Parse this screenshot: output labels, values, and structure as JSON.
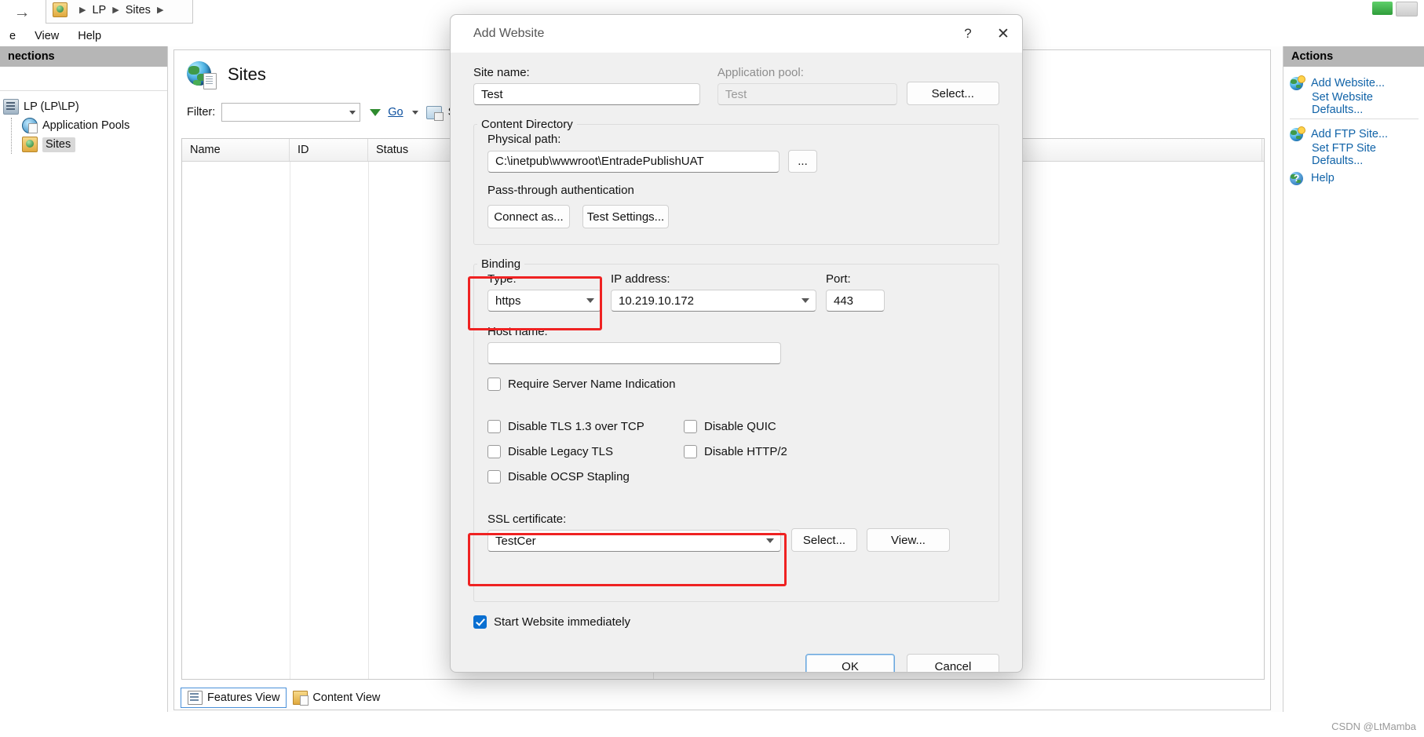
{
  "app": {
    "breadcrumb": [
      "LP",
      "Sites"
    ],
    "menu": [
      "e",
      "View",
      "Help"
    ],
    "menu_full": [
      "File",
      "View",
      "Help"
    ]
  },
  "connections": {
    "header": "nections",
    "header_full": "Connections",
    "tree": [
      {
        "label": "LP (LP\\LP)",
        "icon": "server-icon",
        "selected": false
      },
      {
        "label": "Application Pools",
        "icon": "app-pool-icon",
        "selected": false
      },
      {
        "label": "Sites",
        "icon": "sites-folder-icon",
        "selected": true
      }
    ]
  },
  "center": {
    "title": "Sites",
    "filter_label": "Filter:",
    "filter_value": "",
    "go_label": "Go",
    "show_all_label": "Show",
    "show_all_full": "Show All",
    "columns": [
      "Name",
      "ID",
      "Status"
    ],
    "rows": [],
    "view_tabs": [
      {
        "label": "Features View",
        "active": true
      },
      {
        "label": "Content View",
        "active": false
      }
    ]
  },
  "actions": {
    "header": "Actions",
    "items": [
      {
        "label": "Add Website...",
        "icon": "add-website-icon",
        "sub": false
      },
      {
        "label": "Set Website Defaults...",
        "icon": "",
        "sub": true
      },
      {
        "label": "Add FTP Site...",
        "icon": "add-ftp-site-icon",
        "sub": false
      },
      {
        "label": "Set FTP Site Defaults...",
        "icon": "",
        "sub": true
      },
      {
        "label": "Help",
        "icon": "help-icon",
        "sub": false
      }
    ]
  },
  "dialog": {
    "title": "Add Website",
    "help_glyph": "?",
    "close_glyph": "✕",
    "site_name_label": "Site name:",
    "site_name_value": "Test",
    "app_pool_label": "Application pool:",
    "app_pool_value": "Test",
    "select_app_pool_label": "Select...",
    "content_directory": {
      "legend": "Content Directory",
      "physical_path_label": "Physical path:",
      "physical_path_value": "C:\\inetpub\\wwwroot\\EntradePublishUAT",
      "browse_label": "...",
      "pass_through_label": "Pass-through authentication",
      "connect_as_label": "Connect as...",
      "test_settings_label": "Test Settings..."
    },
    "binding": {
      "legend": "Binding",
      "type_label": "Type:",
      "type_value": "https",
      "ip_label": "IP address:",
      "ip_value": "10.219.10.172",
      "port_label": "Port:",
      "port_value": "443",
      "host_name_label": "Host name:",
      "host_name_value": "",
      "require_sni_label": "Require Server Name Indication",
      "require_sni_checked": false,
      "options": [
        {
          "label": "Disable TLS 1.3 over TCP",
          "checked": false
        },
        {
          "label": "Disable Legacy TLS",
          "checked": false
        },
        {
          "label": "Disable OCSP Stapling",
          "checked": false
        },
        {
          "label": "Disable QUIC",
          "checked": false
        },
        {
          "label": "Disable HTTP/2",
          "checked": false
        }
      ],
      "ssl_certificate_label": "SSL certificate:",
      "ssl_certificate_value": "TestCer",
      "ssl_select_label": "Select...",
      "ssl_view_label": "View..."
    },
    "start_website_label": "Start Website immediately",
    "start_website_checked": true,
    "ok_label": "OK",
    "cancel_label": "Cancel",
    "highlight_color": "#ef2222"
  },
  "watermark": "CSDN @LtMamba"
}
